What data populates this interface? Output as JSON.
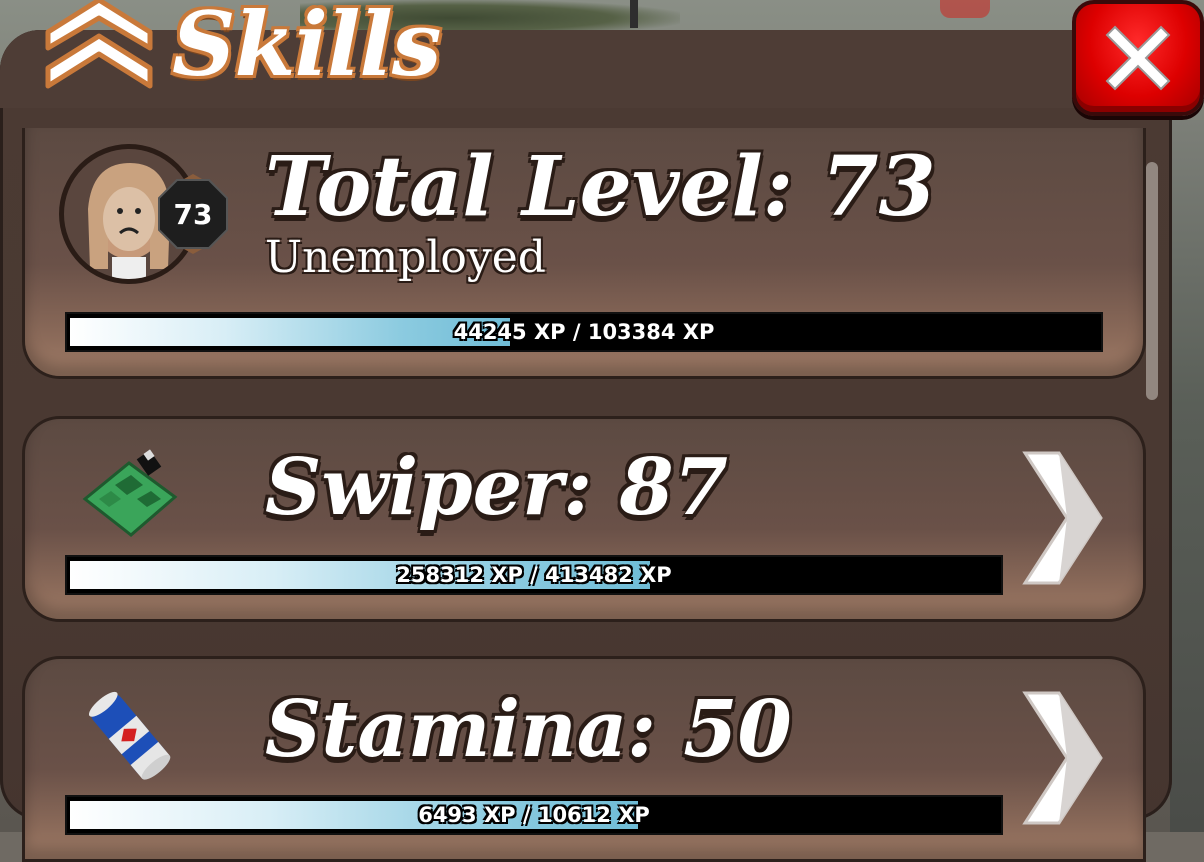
{
  "header": {
    "title": "Skills"
  },
  "close": {
    "icon": "close-x-icon"
  },
  "total": {
    "heading": "Total Level: 73",
    "job": "Unemployed",
    "badge_level": "73",
    "xp_text": "44245 XP / 103384 XP",
    "xp_fraction": 0.428
  },
  "skills": [
    {
      "heading": "Swiper: 87",
      "xp_text": "258312 XP / 413482 XP",
      "xp_fraction": 0.625,
      "icon": "circuit-board-icon"
    },
    {
      "heading": "Stamina: 50",
      "xp_text": "6493 XP / 10612 XP",
      "xp_fraction": 0.612,
      "icon": "energy-can-icon"
    }
  ],
  "colors": {
    "panel": "#4a3932",
    "bar_fill": "#8ccbe0",
    "close": "#dd0000",
    "title_outline": "#c9793a"
  }
}
